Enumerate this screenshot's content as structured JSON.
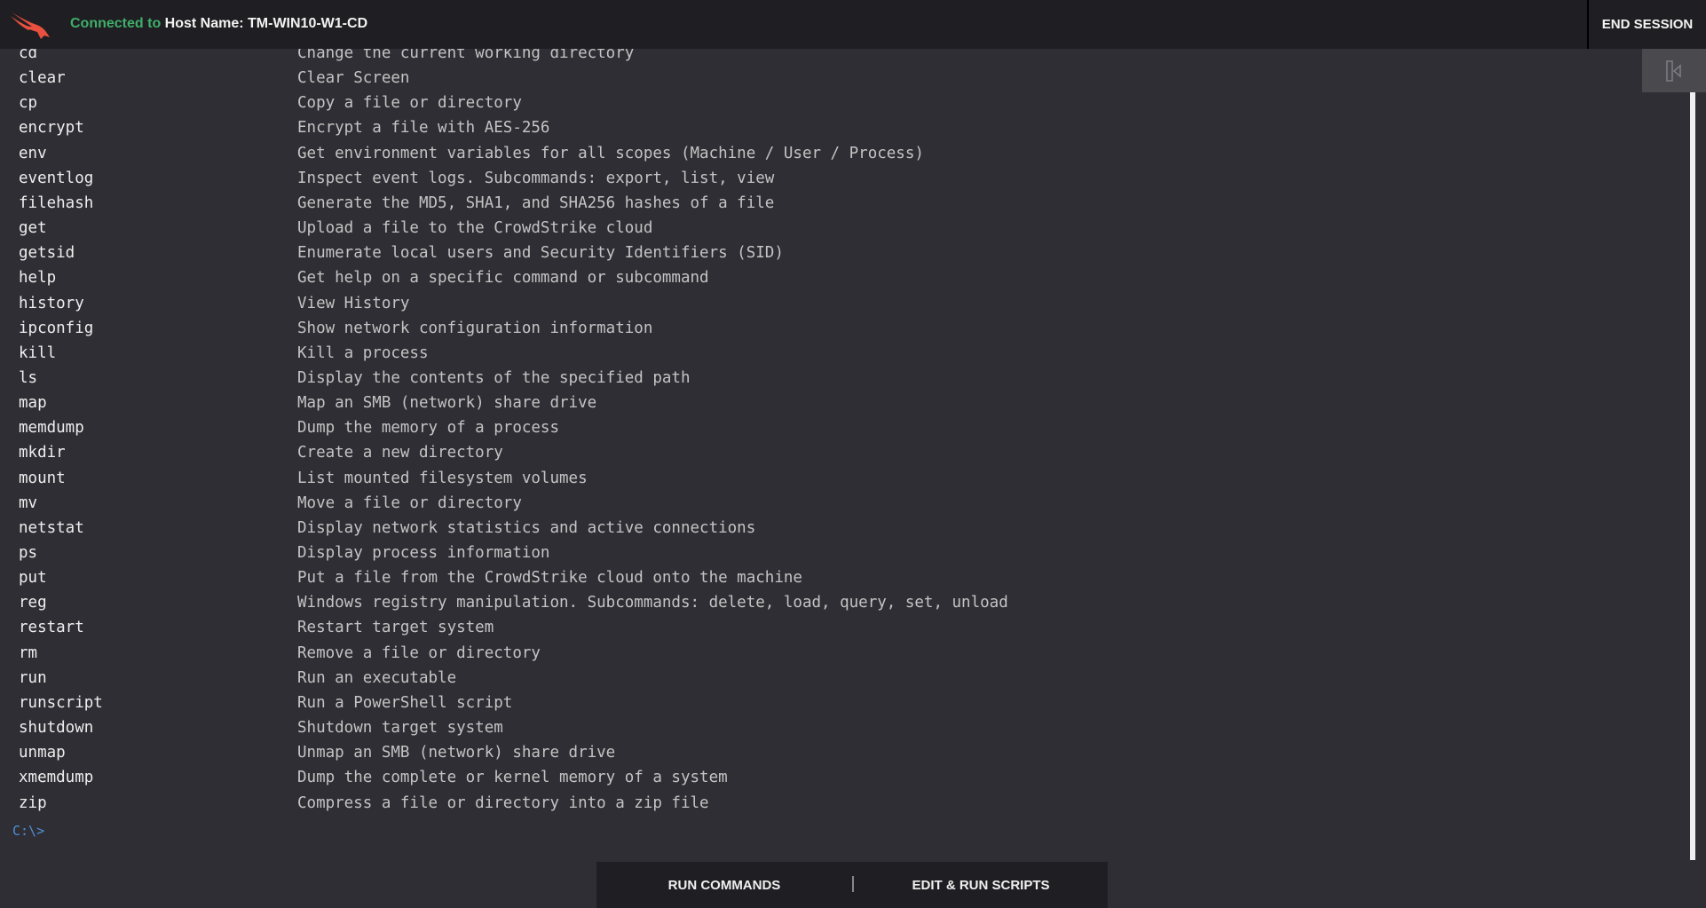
{
  "header": {
    "connected_label": "Connected to",
    "host_label": "Host Name: TM-WIN10-W1-CD",
    "end_session": "END SESSION",
    "logo_icon": "crowdstrike-falcon-logo",
    "colors": {
      "connected": "#3fae6a",
      "logo": "#e8503f"
    }
  },
  "terminal": {
    "commands": [
      {
        "cmd": "cd",
        "desc": "Change the current working directory"
      },
      {
        "cmd": "clear",
        "desc": "Clear Screen"
      },
      {
        "cmd": "cp",
        "desc": "Copy a file or directory"
      },
      {
        "cmd": "encrypt",
        "desc": "Encrypt a file with AES-256"
      },
      {
        "cmd": "env",
        "desc": "Get environment variables for all scopes (Machine / User / Process)"
      },
      {
        "cmd": "eventlog",
        "desc": "Inspect event logs. Subcommands: export, list, view"
      },
      {
        "cmd": "filehash",
        "desc": "Generate the MD5, SHA1, and SHA256 hashes of a file"
      },
      {
        "cmd": "get",
        "desc": "Upload a file to the CrowdStrike cloud"
      },
      {
        "cmd": "getsid",
        "desc": "Enumerate local users and Security Identifiers (SID)"
      },
      {
        "cmd": "help",
        "desc": "Get help on a specific command or subcommand"
      },
      {
        "cmd": "history",
        "desc": "View History"
      },
      {
        "cmd": "ipconfig",
        "desc": "Show network configuration information"
      },
      {
        "cmd": "kill",
        "desc": "Kill a process"
      },
      {
        "cmd": "ls",
        "desc": "Display the contents of the specified path"
      },
      {
        "cmd": "map",
        "desc": "Map an SMB (network) share drive"
      },
      {
        "cmd": "memdump",
        "desc": "Dump the memory of a process"
      },
      {
        "cmd": "mkdir",
        "desc": "Create a new directory"
      },
      {
        "cmd": "mount",
        "desc": "List mounted filesystem volumes"
      },
      {
        "cmd": "mv",
        "desc": "Move a file or directory"
      },
      {
        "cmd": "netstat",
        "desc": "Display network statistics and active connections"
      },
      {
        "cmd": "ps",
        "desc": "Display process information"
      },
      {
        "cmd": "put",
        "desc": "Put a file from the CrowdStrike cloud onto the machine"
      },
      {
        "cmd": "reg",
        "desc": "Windows registry manipulation. Subcommands: delete, load, query, set, unload"
      },
      {
        "cmd": "restart",
        "desc": "Restart target system"
      },
      {
        "cmd": "rm",
        "desc": "Remove a file or directory"
      },
      {
        "cmd": "run",
        "desc": "Run an executable"
      },
      {
        "cmd": "runscript",
        "desc": "Run a PowerShell script"
      },
      {
        "cmd": "shutdown",
        "desc": "Shutdown target system"
      },
      {
        "cmd": "unmap",
        "desc": "Unmap an SMB (network) share drive"
      },
      {
        "cmd": "xmemdump",
        "desc": "Dump the complete or kernel memory of a system"
      },
      {
        "cmd": "zip",
        "desc": "Compress a file or directory into a zip file"
      }
    ],
    "prompt": "C:\\>"
  },
  "side_panel": {
    "toggle_icon": "panel-collapse-icon"
  },
  "bottom_tabs": {
    "run_commands": "RUN COMMANDS",
    "edit_run_scripts": "EDIT & RUN SCRIPTS"
  }
}
